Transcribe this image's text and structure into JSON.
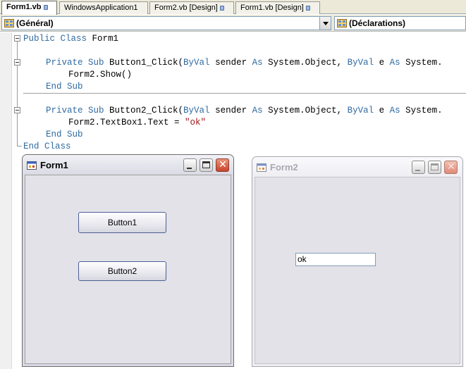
{
  "tabs": [
    {
      "label": "Form1.vb",
      "active": true,
      "locked": true
    },
    {
      "label": "WindowsApplication1",
      "active": false,
      "locked": false
    },
    {
      "label": "Form2.vb [Design]",
      "active": false,
      "locked": true
    },
    {
      "label": "Form1.vb [Design]",
      "active": false,
      "locked": true
    }
  ],
  "combos": {
    "left": {
      "value": "(Général)",
      "icon": "class-icon"
    },
    "right": {
      "value": "(Déclarations)",
      "icon": "members-icon"
    }
  },
  "code": {
    "line1": {
      "kw1": "Public Class",
      "t1": " Form1"
    },
    "line3": {
      "kw1": "Private Sub",
      "t1": " Button1_Click(",
      "kw2": "ByVal",
      "t2": " sender ",
      "kw3": "As",
      "t3": " System.Object, ",
      "kw4": "ByVal",
      "t4": " e ",
      "kw5": "As",
      "t5": " System."
    },
    "line4": {
      "t1": "Form2.Show()"
    },
    "line5": {
      "kw1": "End Sub"
    },
    "line7": {
      "kw1": "Private Sub",
      "t1": " Button2_Click(",
      "kw2": "ByVal",
      "t2": " sender ",
      "kw3": "As",
      "t3": " System.Object, ",
      "kw4": "ByVal",
      "t4": " e ",
      "kw5": "As",
      "t5": " System."
    },
    "line8": {
      "t1": "Form2.TextBox1.Text = ",
      "s1": "\"ok\""
    },
    "line9": {
      "kw1": "End Sub"
    },
    "line10": {
      "kw1": "End Class"
    }
  },
  "form1": {
    "title": "Form1",
    "button1": "Button1",
    "button2": "Button2"
  },
  "form2": {
    "title": "Form2",
    "textbox_value": "ok"
  },
  "colors": {
    "keyword": "#2f6ba1",
    "string": "#a31515",
    "active_titlebar": "#d9dae4",
    "inactive_titlebar": "#eeeef3"
  }
}
